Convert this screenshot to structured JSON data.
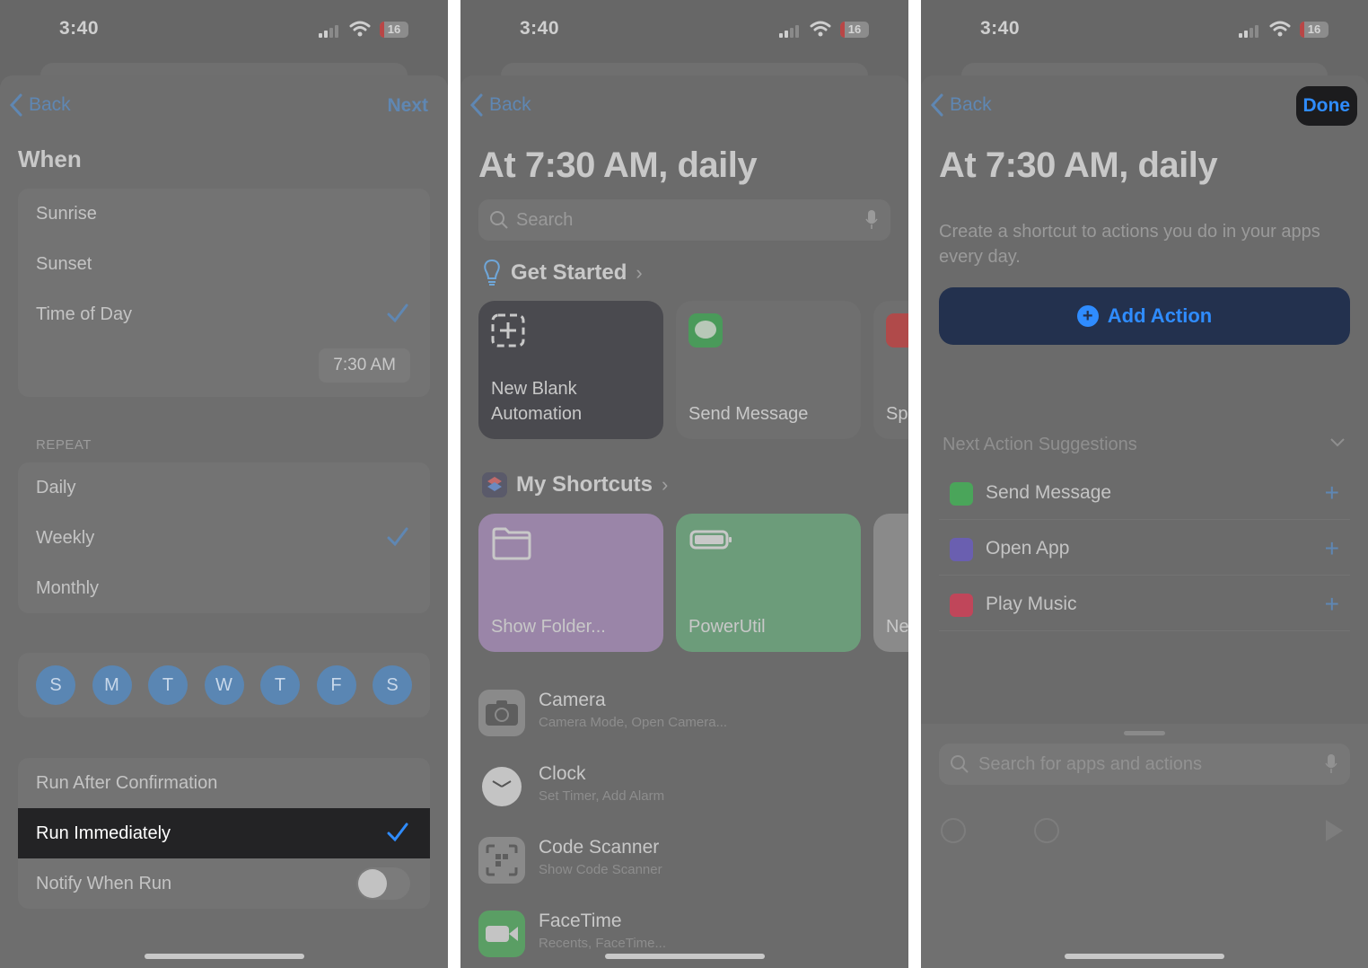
{
  "status_bar": {
    "time": "3:40",
    "battery": "16"
  },
  "screen1": {
    "nav": {
      "back": "Back",
      "next": "Next"
    },
    "title": "When",
    "when_options": [
      {
        "label": "Sunrise",
        "checked": false
      },
      {
        "label": "Sunset",
        "checked": false
      },
      {
        "label": "Time of Day",
        "checked": true
      }
    ],
    "time_value": "7:30 AM",
    "repeat_header": "REPEAT",
    "repeat_options": [
      {
        "label": "Daily",
        "checked": false
      },
      {
        "label": "Weekly",
        "checked": true
      },
      {
        "label": "Monthly",
        "checked": false
      }
    ],
    "days": [
      "S",
      "M",
      "T",
      "W",
      "T",
      "F",
      "S"
    ],
    "run_options": [
      {
        "label": "Run After Confirmation",
        "checked": false
      },
      {
        "label": "Run Immediately",
        "checked": true
      }
    ],
    "notify": {
      "label": "Notify When Run",
      "on": false
    }
  },
  "screen2": {
    "nav": {
      "back": "Back"
    },
    "title": "At 7:30 AM, daily",
    "search_placeholder": "Search",
    "get_started": {
      "title": "Get Started",
      "cards": [
        "New Blank Automation",
        "Send Message",
        "Sp"
      ]
    },
    "my_shortcuts": {
      "title": "My Shortcuts",
      "cards": [
        "Show Folder...",
        "PowerUtil",
        "Ne"
      ]
    },
    "apps": [
      {
        "name": "Camera",
        "sub": "Camera Mode, Open Camera..."
      },
      {
        "name": "Clock",
        "sub": "Set Timer, Add Alarm"
      },
      {
        "name": "Code Scanner",
        "sub": "Show Code Scanner"
      },
      {
        "name": "FaceTime",
        "sub": "Recents, FaceTime..."
      }
    ]
  },
  "screen3": {
    "nav": {
      "back": "Back",
      "done": "Done"
    },
    "title": "At 7:30 AM, daily",
    "description": "Create a shortcut to actions you do in your apps every day.",
    "add_action": "Add Action",
    "suggestions_header": "Next Action Suggestions",
    "suggestions": [
      {
        "name": "Send Message",
        "color": "#4aa55a"
      },
      {
        "name": "Open App",
        "color": "#6a5fb0"
      },
      {
        "name": "Play Music",
        "color": "#c0465a"
      }
    ],
    "search_placeholder": "Search for apps and actions"
  },
  "colors": {
    "accent": "#2f8cff",
    "dim_background": "#676767"
  }
}
